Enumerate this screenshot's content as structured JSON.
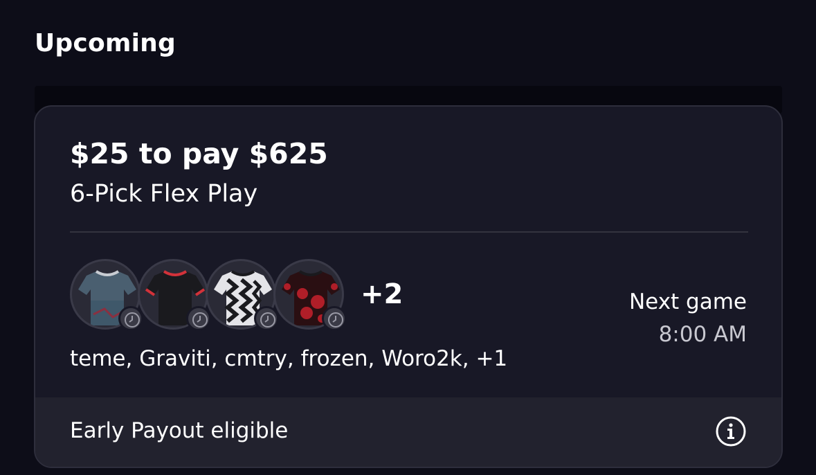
{
  "section": {
    "title": "Upcoming"
  },
  "entry": {
    "headline": "$25 to pay $625",
    "play_type": "6-Pick Flex Play",
    "avatars": [
      {
        "icon": "jersey-icon",
        "style": "blue-gray"
      },
      {
        "icon": "jersey-icon",
        "style": "black-red"
      },
      {
        "icon": "jersey-icon",
        "style": "black-white-zigzag"
      },
      {
        "icon": "jersey-icon",
        "style": "red-black-pattern"
      }
    ],
    "more_count": "+2",
    "player_names": "teme, Graviti, cmtry, frozen, Woro2k, +1",
    "next_game_label": "Next game",
    "next_game_time": "8:00 AM",
    "footer_label": "Early Payout eligible",
    "footer_icon": "info-icon"
  },
  "colors": {
    "background": "#0d0d18",
    "card": "#181826",
    "footer": "#22222e",
    "text": "#ffffff",
    "muted_text": "#c8c8d0"
  }
}
